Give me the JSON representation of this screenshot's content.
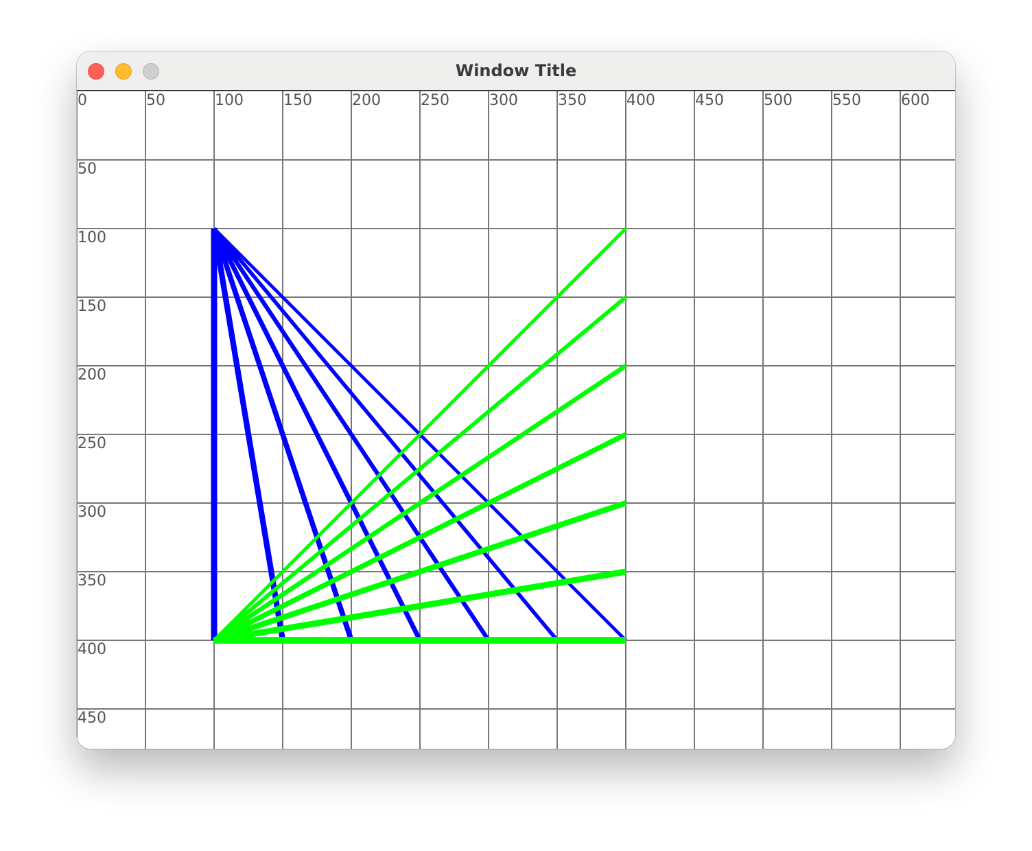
{
  "window": {
    "title": "Window Title",
    "buttons": [
      {
        "name": "close",
        "color": "#ff5f57"
      },
      {
        "name": "minimize",
        "color": "#febc2e"
      },
      {
        "name": "zoom",
        "color": "#cfcfcf"
      }
    ]
  },
  "chart_data": {
    "type": "line",
    "grid": true,
    "grid_step": 50,
    "x_ticks": [
      "0",
      "50",
      "100",
      "150",
      "200",
      "250",
      "300",
      "350",
      "400",
      "450",
      "500",
      "550",
      "600"
    ],
    "y_ticks": [
      "50",
      "100",
      "150",
      "200",
      "250",
      "300",
      "350",
      "400",
      "450"
    ],
    "blue_color": "#0000ff",
    "green_color": "#00ff00",
    "grid_color": "#777777",
    "label_color": "#555555",
    "blue_lines": [
      {
        "from": [
          100,
          100
        ],
        "to": [
          100,
          400
        ]
      },
      {
        "from": [
          100,
          100
        ],
        "to": [
          150,
          400
        ]
      },
      {
        "from": [
          100,
          100
        ],
        "to": [
          200,
          400
        ]
      },
      {
        "from": [
          100,
          100
        ],
        "to": [
          250,
          400
        ]
      },
      {
        "from": [
          100,
          100
        ],
        "to": [
          300,
          400
        ]
      },
      {
        "from": [
          100,
          100
        ],
        "to": [
          350,
          400
        ]
      },
      {
        "from": [
          100,
          100
        ],
        "to": [
          400,
          400
        ]
      }
    ],
    "green_lines": [
      {
        "from": [
          100,
          400
        ],
        "to": [
          400,
          100
        ]
      },
      {
        "from": [
          100,
          400
        ],
        "to": [
          400,
          150
        ]
      },
      {
        "from": [
          100,
          400
        ],
        "to": [
          400,
          200
        ]
      },
      {
        "from": [
          100,
          400
        ],
        "to": [
          400,
          250
        ]
      },
      {
        "from": [
          100,
          400
        ],
        "to": [
          400,
          300
        ]
      },
      {
        "from": [
          100,
          400
        ],
        "to": [
          400,
          350
        ]
      },
      {
        "from": [
          100,
          400
        ],
        "to": [
          400,
          400
        ]
      }
    ]
  }
}
